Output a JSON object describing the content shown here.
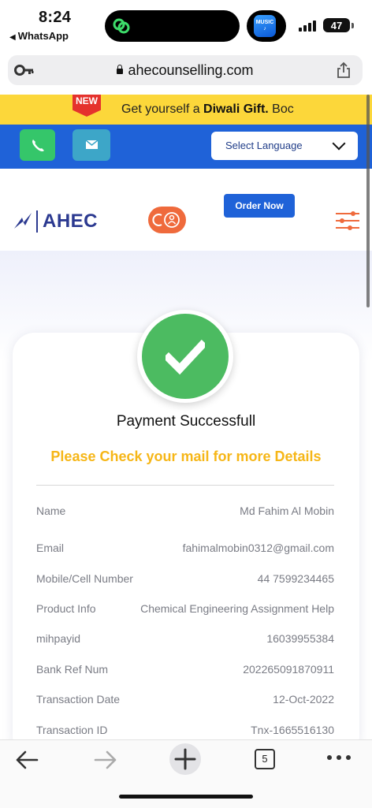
{
  "status_bar": {
    "time": "8:24",
    "back_app": "WhatsApp",
    "music_label": "MUSIC",
    "battery": "47"
  },
  "address_bar": {
    "url": "ahecounselling.com"
  },
  "promo": {
    "badge": "NEW",
    "text_prefix": "Get yourself a ",
    "text_bold": "Diwali Gift.",
    "text_suffix": " Boc"
  },
  "contact_bar": {
    "language_select": "Select Language"
  },
  "header": {
    "logo_text": "AHEC",
    "order_button": "Order Now"
  },
  "card": {
    "title": "Payment Successfull",
    "subtitle": "Please Check your mail for more Details",
    "rows": [
      {
        "label": "Name",
        "value": "Md Fahim Al Mobin"
      },
      {
        "label": "Email",
        "value": "fahimalmobin0312@gmail.com"
      },
      {
        "label": "Mobile/Cell Number",
        "value": "44 7599234465"
      },
      {
        "label": "Product Info",
        "value": "Chemical Engineering Assignment Help"
      },
      {
        "label": "mihpayid",
        "value": "16039955384"
      },
      {
        "label": "Bank Ref Num",
        "value": "202265091870911"
      },
      {
        "label": "Transaction Date",
        "value": "12-Oct-2022"
      },
      {
        "label": "Transaction ID",
        "value": "Tnx-1665516130"
      }
    ]
  },
  "toolbar": {
    "tab_count": "5"
  },
  "colors": {
    "brand_blue": "#1f62d8",
    "promo_yellow": "#fcd73a",
    "success_green": "#4cbb61",
    "accent_orange": "#ef6a3c",
    "subtitle_gold": "#f6b617"
  },
  "icons": [
    "key-icon",
    "lock-icon",
    "share-icon",
    "phone-icon",
    "mail-icon",
    "chevron-down-icon",
    "bird-logo-icon",
    "chat-icon",
    "menu-sliders-icon",
    "check-icon",
    "back-arrow-icon",
    "forward-arrow-icon",
    "plus-icon",
    "tabs-icon",
    "more-icon"
  ]
}
